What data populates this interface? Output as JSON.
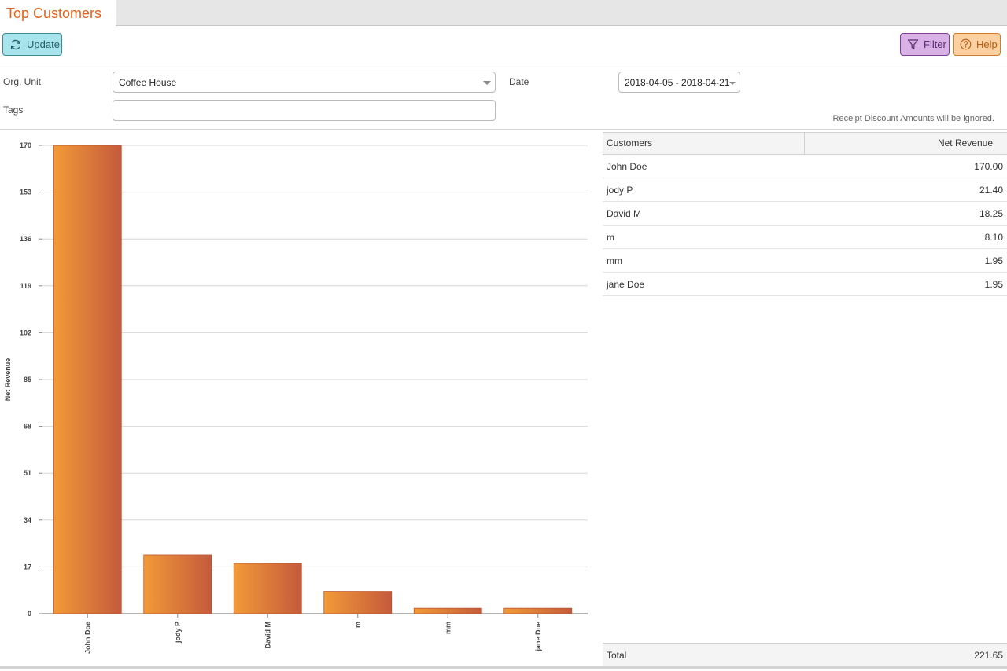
{
  "tab": {
    "title": "Top Customers"
  },
  "toolbar": {
    "update_label": "Update",
    "filter_label": "Filter",
    "help_label": "Help"
  },
  "form": {
    "org_unit_label": "Org. Unit",
    "org_unit_value": "Coffee House",
    "date_label": "Date",
    "date_value": "2018-04-05 - 2018-04-21",
    "tags_label": "Tags",
    "tags_value": "",
    "note": "Receipt Discount Amounts will be ignored."
  },
  "colors": {
    "accent": "#e0641e",
    "bar_start": "#f29a38",
    "bar_end": "#c45a3c"
  },
  "table": {
    "headers": [
      "Customers",
      "Net Revenue"
    ],
    "rows": [
      {
        "name": "John Doe",
        "value": "170.00"
      },
      {
        "name": "jody P",
        "value": "21.40"
      },
      {
        "name": "David M",
        "value": "18.25"
      },
      {
        "name": "m",
        "value": "8.10"
      },
      {
        "name": "mm",
        "value": "1.95"
      },
      {
        "name": "jane Doe",
        "value": "1.95"
      }
    ],
    "total_label": "Total",
    "total_value": "221.65"
  },
  "chart_data": {
    "type": "bar",
    "categories": [
      "John Doe",
      "jody P",
      "David M",
      "m",
      "mm",
      "jane Doe"
    ],
    "values": [
      170.0,
      21.4,
      18.25,
      8.1,
      1.95,
      1.95
    ],
    "ylabel": "Net Revenue",
    "xlabel": "",
    "ylim": [
      0,
      170
    ],
    "yticks": [
      "0",
      "17",
      "34",
      "51",
      "68",
      "85",
      "102",
      "119",
      "136",
      "153",
      "170"
    ],
    "grid": true
  }
}
